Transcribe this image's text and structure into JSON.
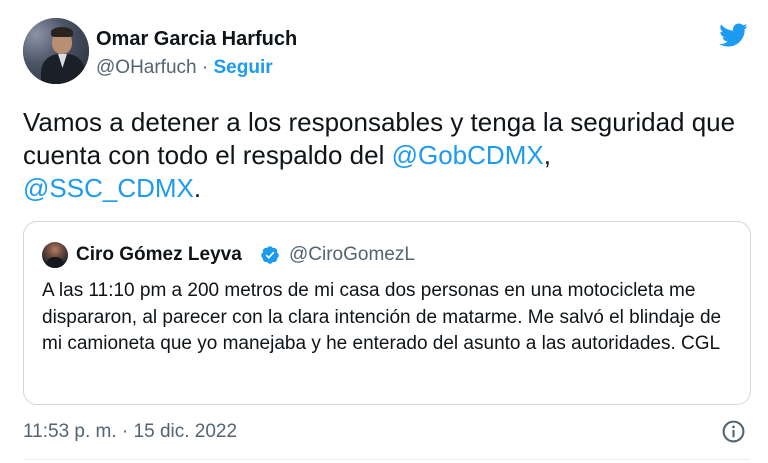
{
  "author": {
    "name": "Omar Garcia Harfuch",
    "handle": "@OHarfuch",
    "separator": "·",
    "follow_label": "Seguir"
  },
  "tweet": {
    "text_before": "Vamos a detener a los responsables y tenga la seguridad que cuenta con todo el respaldo del ",
    "mention1": "@GobCDMX",
    "comma": ",",
    "mention2": "@SSC_CDMX",
    "text_after": "."
  },
  "quoted": {
    "name": "Ciro Gómez Leyva",
    "handle": "@CiroGomezL",
    "text": "A las 11:10 pm a 200 metros de mi casa dos personas en una motocicleta me dispararon, al parecer con la clara intención de matarme. Me salvó el blindaje de mi camioneta que yo manejaba y he enterado del asunto a las autoridades. CGL"
  },
  "timestamp": "11:53 p. m. · 15 dic. 2022",
  "icons": {
    "logo": "twitter-bird-icon",
    "verified": "verified-badge-icon",
    "info": "info-icon"
  },
  "colors": {
    "accent": "#1d9bf0",
    "text": "#0f1419",
    "secondary": "#536471",
    "border": "#cfd9de"
  }
}
